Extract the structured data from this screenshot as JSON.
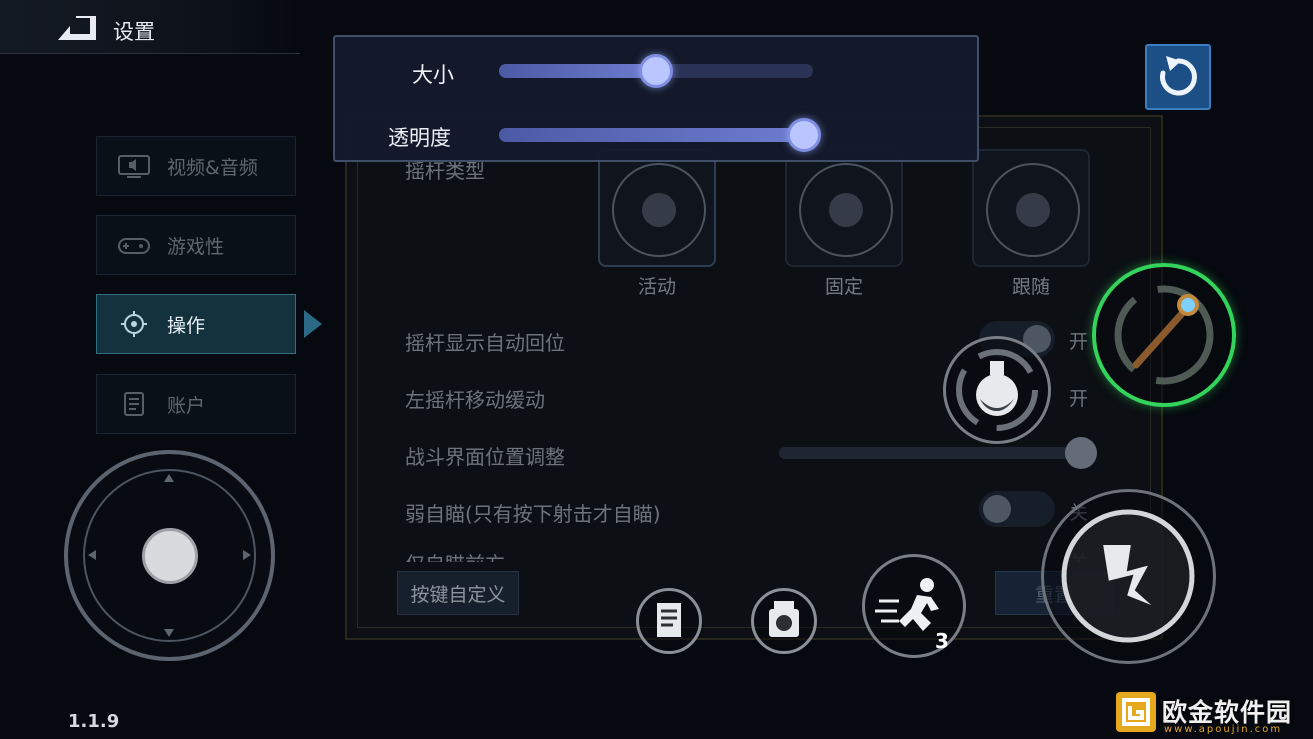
{
  "header": {
    "title": "设置"
  },
  "sidebar": {
    "items": [
      {
        "label": "视频&音频",
        "icon": "monitor-speaker-icon"
      },
      {
        "label": "游戏性",
        "icon": "gamepad-icon"
      },
      {
        "label": "操作",
        "icon": "crosshair-icon",
        "active": true
      },
      {
        "label": "账户",
        "icon": "document-icon"
      }
    ]
  },
  "popup": {
    "size_label": "大小",
    "size_value": 0.5,
    "opacity_label": "透明度",
    "opacity_value": 0.97
  },
  "panel": {
    "joystick_type_label": "摇杆类型",
    "joystick_types": [
      "活动",
      "固定",
      "跟随"
    ],
    "rows": [
      {
        "label": "摇杆显示自动回位",
        "state": "开"
      },
      {
        "label": "左摇杆移动缓动",
        "state": "开"
      },
      {
        "label": "战斗界面位置调整",
        "slider_value": 1.0
      },
      {
        "label": "弱自瞄(只有按下射击才自瞄)",
        "state": "关"
      },
      {
        "label": "仅自瞄前方",
        "state": "关"
      }
    ],
    "custom_keys_button": "按键自定义",
    "reset_button": "重置"
  },
  "skills": {
    "dash_count": "3"
  },
  "version": "1.1.9",
  "watermark": {
    "name": "欧金软件园",
    "url": "www.apoujin.com"
  },
  "colors": {
    "accent_blue": "#1d4f87",
    "highlight_green": "#2fd35a",
    "slider_thumb": "#b9c6ff"
  }
}
